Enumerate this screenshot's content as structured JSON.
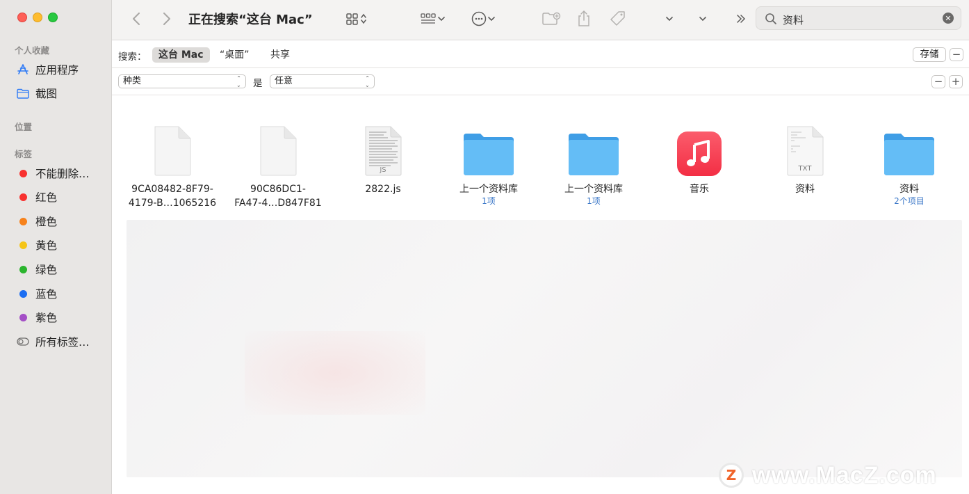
{
  "window": {
    "title": "正在搜索“这台 Mac”"
  },
  "sidebar": {
    "favorites_header": "个人收藏",
    "favorites": [
      {
        "label": "应用程序",
        "icon": "apps-icon"
      },
      {
        "label": "截图",
        "icon": "folder-icon"
      }
    ],
    "locations_header": "位置",
    "tags_header": "标签",
    "tags": [
      {
        "label": "不能删除…",
        "color": "#f8312f"
      },
      {
        "label": "红色",
        "color": "#f8312f"
      },
      {
        "label": "橙色",
        "color": "#f7821b"
      },
      {
        "label": "黄色",
        "color": "#f5c518"
      },
      {
        "label": "绿色",
        "color": "#2bb52e"
      },
      {
        "label": "蓝色",
        "color": "#1c6ef2"
      },
      {
        "label": "紫色",
        "color": "#a44fc6"
      },
      {
        "label": "所有标签…",
        "color": ""
      }
    ]
  },
  "toolbar": {
    "search_value": "资料"
  },
  "scope": {
    "label": "搜索：",
    "tabs": [
      "这台 Mac",
      "“桌面”",
      "共享"
    ],
    "active_index": 0,
    "save_label": "存储"
  },
  "criteria": {
    "attribute": "种类",
    "operator": "是",
    "value": "任意"
  },
  "files": [
    {
      "name_line1": "9CA08482-8F79-",
      "name_line2": "4179-B…1065216",
      "sub": "",
      "type": "doc"
    },
    {
      "name_line1": "90C86DC1-",
      "name_line2": "FA47-4…D847F81",
      "sub": "",
      "type": "doc"
    },
    {
      "name_line1": "2822.js",
      "name_line2": "",
      "sub": "",
      "type": "js",
      "badge": "JS"
    },
    {
      "name_line1": "上一个资料库",
      "name_line2": "",
      "sub": "1项",
      "type": "folder"
    },
    {
      "name_line1": "上一个资料库",
      "name_line2": "",
      "sub": "1项",
      "type": "folder"
    },
    {
      "name_line1": "音乐",
      "name_line2": "",
      "sub": "",
      "type": "music"
    },
    {
      "name_line1": "资料",
      "name_line2": "",
      "sub": "",
      "type": "txt",
      "badge": "TXT"
    },
    {
      "name_line1": "资料",
      "name_line2": "",
      "sub": "2个项目",
      "type": "folder"
    }
  ],
  "watermark": {
    "logo_letter": "Z",
    "text": "www.MacZ.com"
  },
  "colors": {
    "folder": "#5cb8f5",
    "folder_top": "#3f9ee6",
    "music": "#fb3c4b",
    "link_sub": "#3c78c8"
  }
}
